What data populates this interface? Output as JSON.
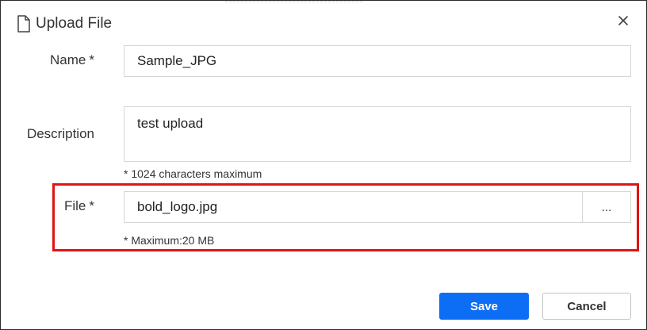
{
  "dialog": {
    "title": "Upload File",
    "icons": {
      "title": "file-icon",
      "close": "close-icon"
    }
  },
  "form": {
    "name": {
      "label": "Name",
      "required_mark": "*",
      "value": "Sample_JPG"
    },
    "description": {
      "label": "Description",
      "value": "test upload",
      "hint": "* 1024 characters maximum"
    },
    "file": {
      "label": "File",
      "required_mark": "*",
      "value": "bold_logo.jpg",
      "browse_label": "...",
      "hint": "* Maximum:20 MB"
    }
  },
  "actions": {
    "save_label": "Save",
    "cancel_label": "Cancel"
  },
  "colors": {
    "primary": "#0b6ef5",
    "highlight": "#e01414",
    "border": "#d6d6d6",
    "text": "#333333"
  }
}
